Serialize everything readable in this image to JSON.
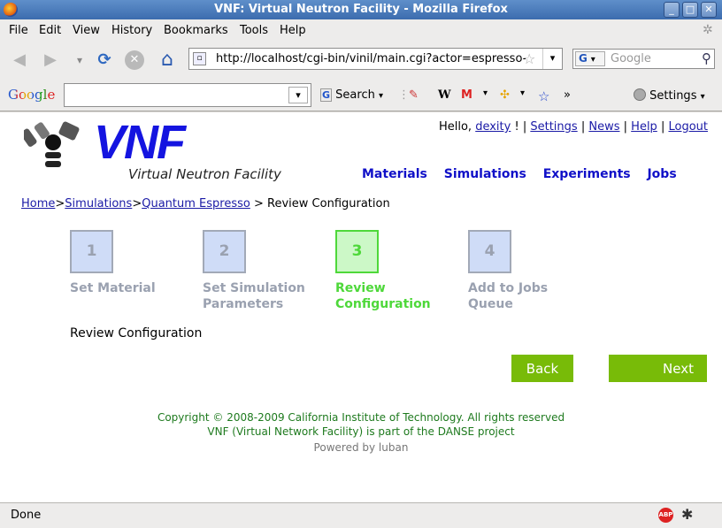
{
  "window": {
    "title": "VNF: Virtual Neutron Facility - Mozilla Firefox",
    "minimize": "_",
    "maximize": "□",
    "close": "✕"
  },
  "menu": [
    "File",
    "Edit",
    "View",
    "History",
    "Bookmarks",
    "Tools",
    "Help"
  ],
  "nav": {
    "back_icon": "◀",
    "forward_icon": "▶",
    "history_icon": "▾",
    "reload_icon": "⟳",
    "stop_icon": "✕",
    "home_icon": "⌂",
    "url": "http://localhost/cgi-bin/vinil/main.cgi?actor=espresso-",
    "search_engine": "G",
    "search_placeholder": "Google"
  },
  "google_toolbar": {
    "logo": "Google",
    "search_label": "Search",
    "more": "»",
    "settings_label": "Settings"
  },
  "page": {
    "logo_text": "VNF",
    "logo_subtitle": "Virtual Neutron Facility",
    "userbar": {
      "hello": "Hello,",
      "username": "dexity",
      "sep1": "! |",
      "settings": "Settings",
      "news": "News",
      "help": "Help",
      "logout": "Logout",
      "sep": "|"
    },
    "main_nav": [
      "Materials",
      "Simulations",
      "Experiments",
      "Jobs"
    ],
    "breadcrumb": {
      "home": "Home",
      "simulations": "Simulations",
      "quantum": "Quantum Espresso",
      "current": "Review Configuration",
      "sep": ">"
    },
    "steps": [
      {
        "num": "1",
        "label": "Set Material"
      },
      {
        "num": "2",
        "label": "Set Simulation Parameters"
      },
      {
        "num": "3",
        "label": "Review Configuration",
        "active": true
      },
      {
        "num": "4",
        "label": "Add to Jobs Queue"
      }
    ],
    "section_title": "Review Configuration",
    "back_button": "Back",
    "next_button": "Next",
    "footer": {
      "copyright": "Copyright © 2008-2009 California Institute of Technology. All rights reserved",
      "project": "VNF (Virtual Network Facility) is part of the DANSE project",
      "powered": "Powered by luban"
    }
  },
  "status": {
    "text": "Done",
    "abp_label": "ABP"
  },
  "colors": {
    "accent_green": "#78bb08",
    "logo_blue": "#1414e0",
    "step_active": "#4ed83a"
  }
}
